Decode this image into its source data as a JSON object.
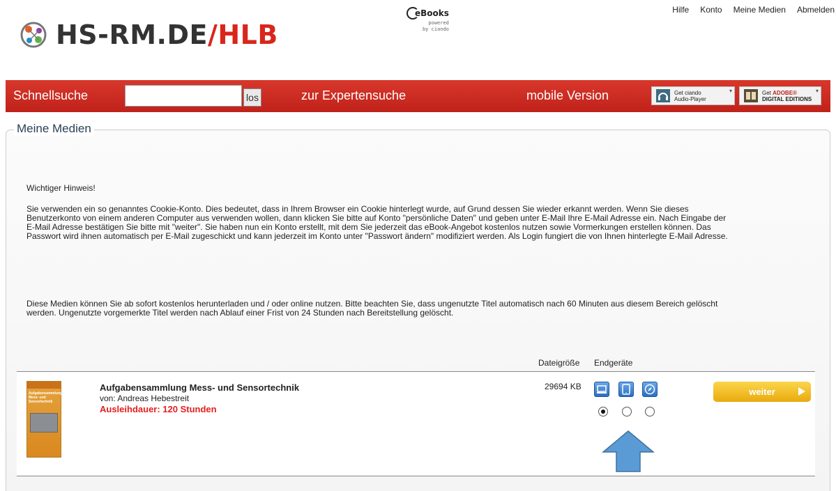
{
  "header": {
    "logo_main": "HS-RM.DE",
    "logo_slash": "/",
    "logo_accent": "HLB",
    "ebooks_brand": "eBooks",
    "ebooks_powered": "powered",
    "ebooks_by": "by ciando",
    "top_links": [
      "Hilfe",
      "Konto",
      "Meine Medien",
      "Abmelden"
    ]
  },
  "searchbar": {
    "quick_search_label": "Schnellsuche",
    "search_value": "",
    "search_button": "los",
    "expert_search": "zur Expertensuche",
    "mobile_version": "mobile Version",
    "badge_audio_line1": "Get ciando",
    "badge_audio_line2": "Audio-Player",
    "badge_adobe_get": "Get",
    "badge_adobe_brand": "ADOBE®",
    "badge_adobe_line2": "DIGITAL EDITIONS",
    "bar_color": "#c8281f"
  },
  "panel": {
    "legend": "Meine Medien",
    "hinweis_title": "Wichtiger Hinweis!",
    "hinweis_body": "Sie verwenden ein so genanntes Cookie-Konto. Dies bedeutet, dass in Ihrem Browser ein Cookie hinterlegt wurde, auf Grund dessen Sie wieder erkannt werden. Wenn Sie dieses Benutzerkonto von einem anderen Computer aus verwenden wollen, dann klicken Sie bitte auf Konto \"persönliche Daten\" und geben unter E-Mail Ihre E-Mail Adresse ein. Nach Eingabe der E-Mail Adresse bestätigen Sie bitte mit \"weiter\". Sie haben nun ein Konto erstellt, mit dem Sie jederzeit das eBook-Angebot kostenlos nutzen sowie Vormerkungen erstellen können. Das Passwort wird ihnen automatisch per E-Mail zugeschickt und kann jederzeit im Konto unter \"Passwort ändern\" modifiziert werden. Als Login fungiert die von Ihnen hinterlegte E-Mail Adresse.",
    "medien_info": "Diese Medien können Sie ab sofort kostenlos herunterladen und / oder online nutzen. Bitte beachten Sie, dass ungenutzte Titel automatisch nach 60 Minuten aus diesem Bereich gelöscht werden. Ungenutzte vorgemerkte Titel werden nach Ablauf einer Frist von 24 Stunden nach Bereitstellung gelöscht.",
    "col_filesize": "Dateigröße",
    "col_devices": "Endgeräte"
  },
  "item": {
    "title": "Aufgabensammlung Mess- und Sensortechnik",
    "author": "von: Andreas Hebestreit",
    "loan": "Ausleihdauer: 120 Stunden",
    "file_size": "29694 KB",
    "cover_title": "Aufgabensammlung Mess- und Sensortechnik",
    "devices": [
      "computer-icon",
      "tablet-icon",
      "browser-icon"
    ],
    "selected_device": 0,
    "action": "weiter",
    "loan_color": "#e51e1e",
    "action_color": "#f2bf2a"
  }
}
